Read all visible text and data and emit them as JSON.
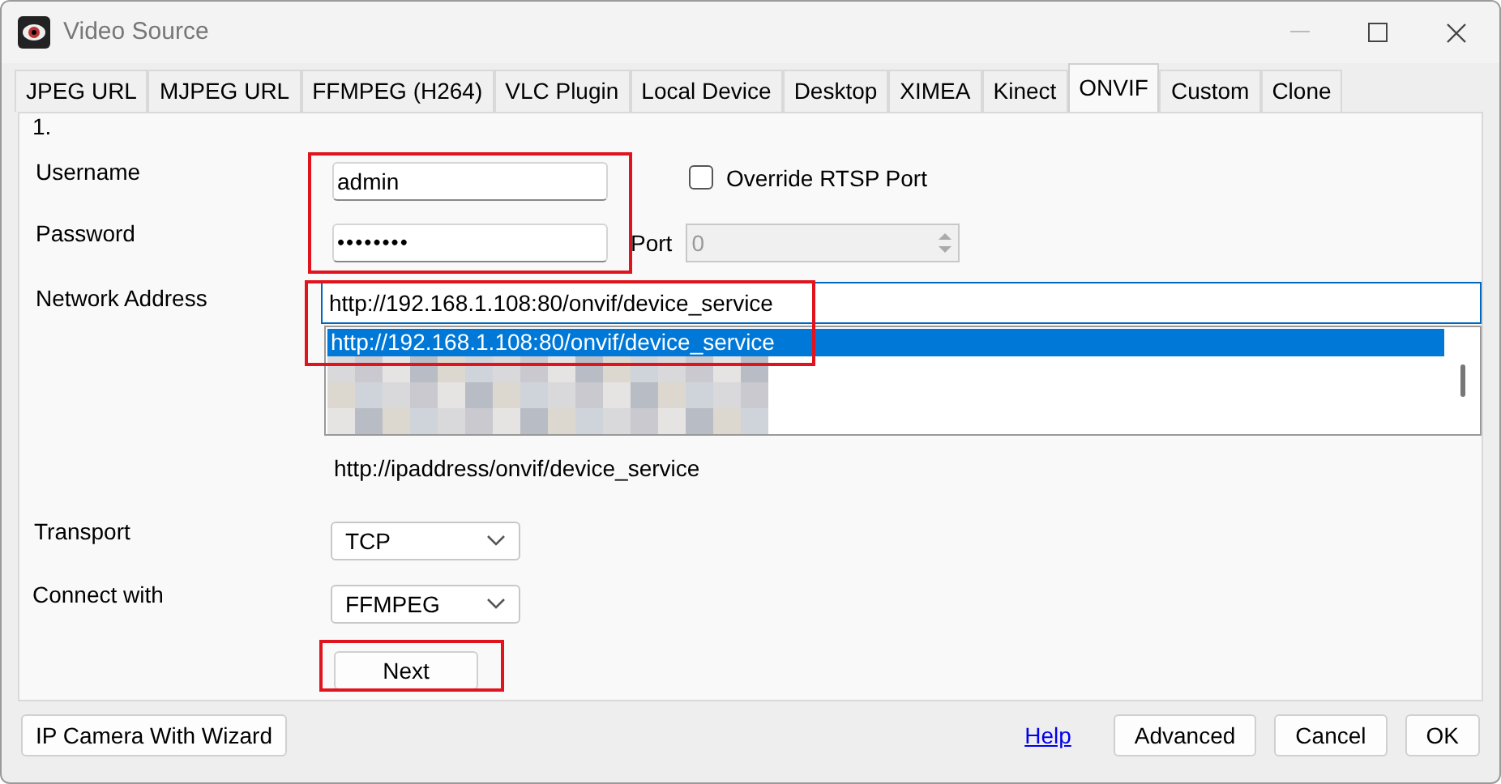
{
  "window": {
    "title": "Video Source"
  },
  "tabs": [
    {
      "label": "JPEG URL",
      "selected": false
    },
    {
      "label": "MJPEG URL",
      "selected": false
    },
    {
      "label": "FFMPEG (H264)",
      "selected": false
    },
    {
      "label": "VLC Plugin",
      "selected": false
    },
    {
      "label": "Local Device",
      "selected": false
    },
    {
      "label": "Desktop",
      "selected": false
    },
    {
      "label": "XIMEA",
      "selected": false
    },
    {
      "label": "Kinect",
      "selected": false
    },
    {
      "label": "ONVIF",
      "selected": true
    },
    {
      "label": "Custom",
      "selected": false
    },
    {
      "label": "Clone",
      "selected": false
    }
  ],
  "panel": {
    "step": "1.",
    "username": {
      "label": "Username",
      "value": "admin"
    },
    "password": {
      "label": "Password",
      "value": "••••••••"
    },
    "override_rtsp_port": {
      "label": "Override RTSP Port",
      "checked": false
    },
    "port": {
      "label": "Port",
      "value": "0",
      "disabled": true
    },
    "network_address": {
      "label": "Network Address",
      "value": "http://192.168.1.108:80/onvif/device_service",
      "suggestions": [
        {
          "text": "http://192.168.1.108:80/onvif/device_service",
          "selected": true
        }
      ]
    },
    "hint": "http://ipaddress/onvif/device_service",
    "transport": {
      "label": "Transport",
      "value": "TCP"
    },
    "connect_with": {
      "label": "Connect with",
      "value": "FFMPEG"
    },
    "next_button": "Next"
  },
  "footer": {
    "wizard_button": "IP Camera With Wizard",
    "help_link": "Help",
    "buttons": [
      "Advanced",
      "Cancel",
      "OK"
    ]
  }
}
